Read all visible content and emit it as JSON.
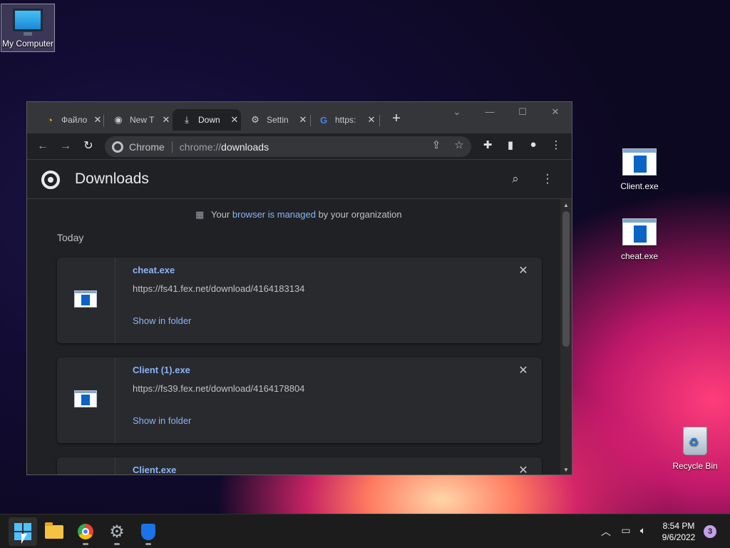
{
  "desktop": {
    "icons": [
      {
        "label": "My Computer",
        "type": "computer"
      },
      {
        "label": "Client.exe",
        "type": "exe"
      },
      {
        "label": "cheat.exe",
        "type": "exe"
      },
      {
        "label": "Recycle Bin",
        "type": "recycle-bin"
      }
    ]
  },
  "browser": {
    "tabs": [
      {
        "title": "Файло",
        "icon": "file-share-icon",
        "close": "✕"
      },
      {
        "title": "New T",
        "icon": "chrome-icon",
        "close": "✕"
      },
      {
        "title": "Down",
        "icon": "download-icon",
        "close": "✕",
        "active": true
      },
      {
        "title": "Settin",
        "icon": "gear-icon",
        "close": "✕"
      },
      {
        "title": "https:",
        "icon": "google-icon",
        "close": "✕"
      }
    ],
    "new_tab": "+",
    "omnibox": {
      "chip": "Chrome",
      "scheme": "chrome://",
      "host": "downloads"
    }
  },
  "downloads_page": {
    "title": "Downloads",
    "managed_notice": {
      "prefix": "Your ",
      "link": "browser is managed",
      "suffix": " by your organization"
    },
    "section_label": "Today",
    "items": [
      {
        "name": "cheat.exe",
        "url": "https://fs41.fex.net/download/4164183134",
        "action": "Show in folder"
      },
      {
        "name": "Client (1).exe",
        "url": "https://fs39.fex.net/download/4164178804",
        "action": "Show in folder"
      },
      {
        "name": "Client.exe",
        "url": "",
        "action": ""
      }
    ]
  },
  "taskbar": {
    "time": "8:54 PM",
    "date": "9/6/2022",
    "notification_count": "3"
  },
  "colors": {
    "accent_link": "#8ab4f8",
    "window_bg": "#202124",
    "tabstrip_bg": "#35363a",
    "taskbar_bg": "#1c1c1c"
  }
}
